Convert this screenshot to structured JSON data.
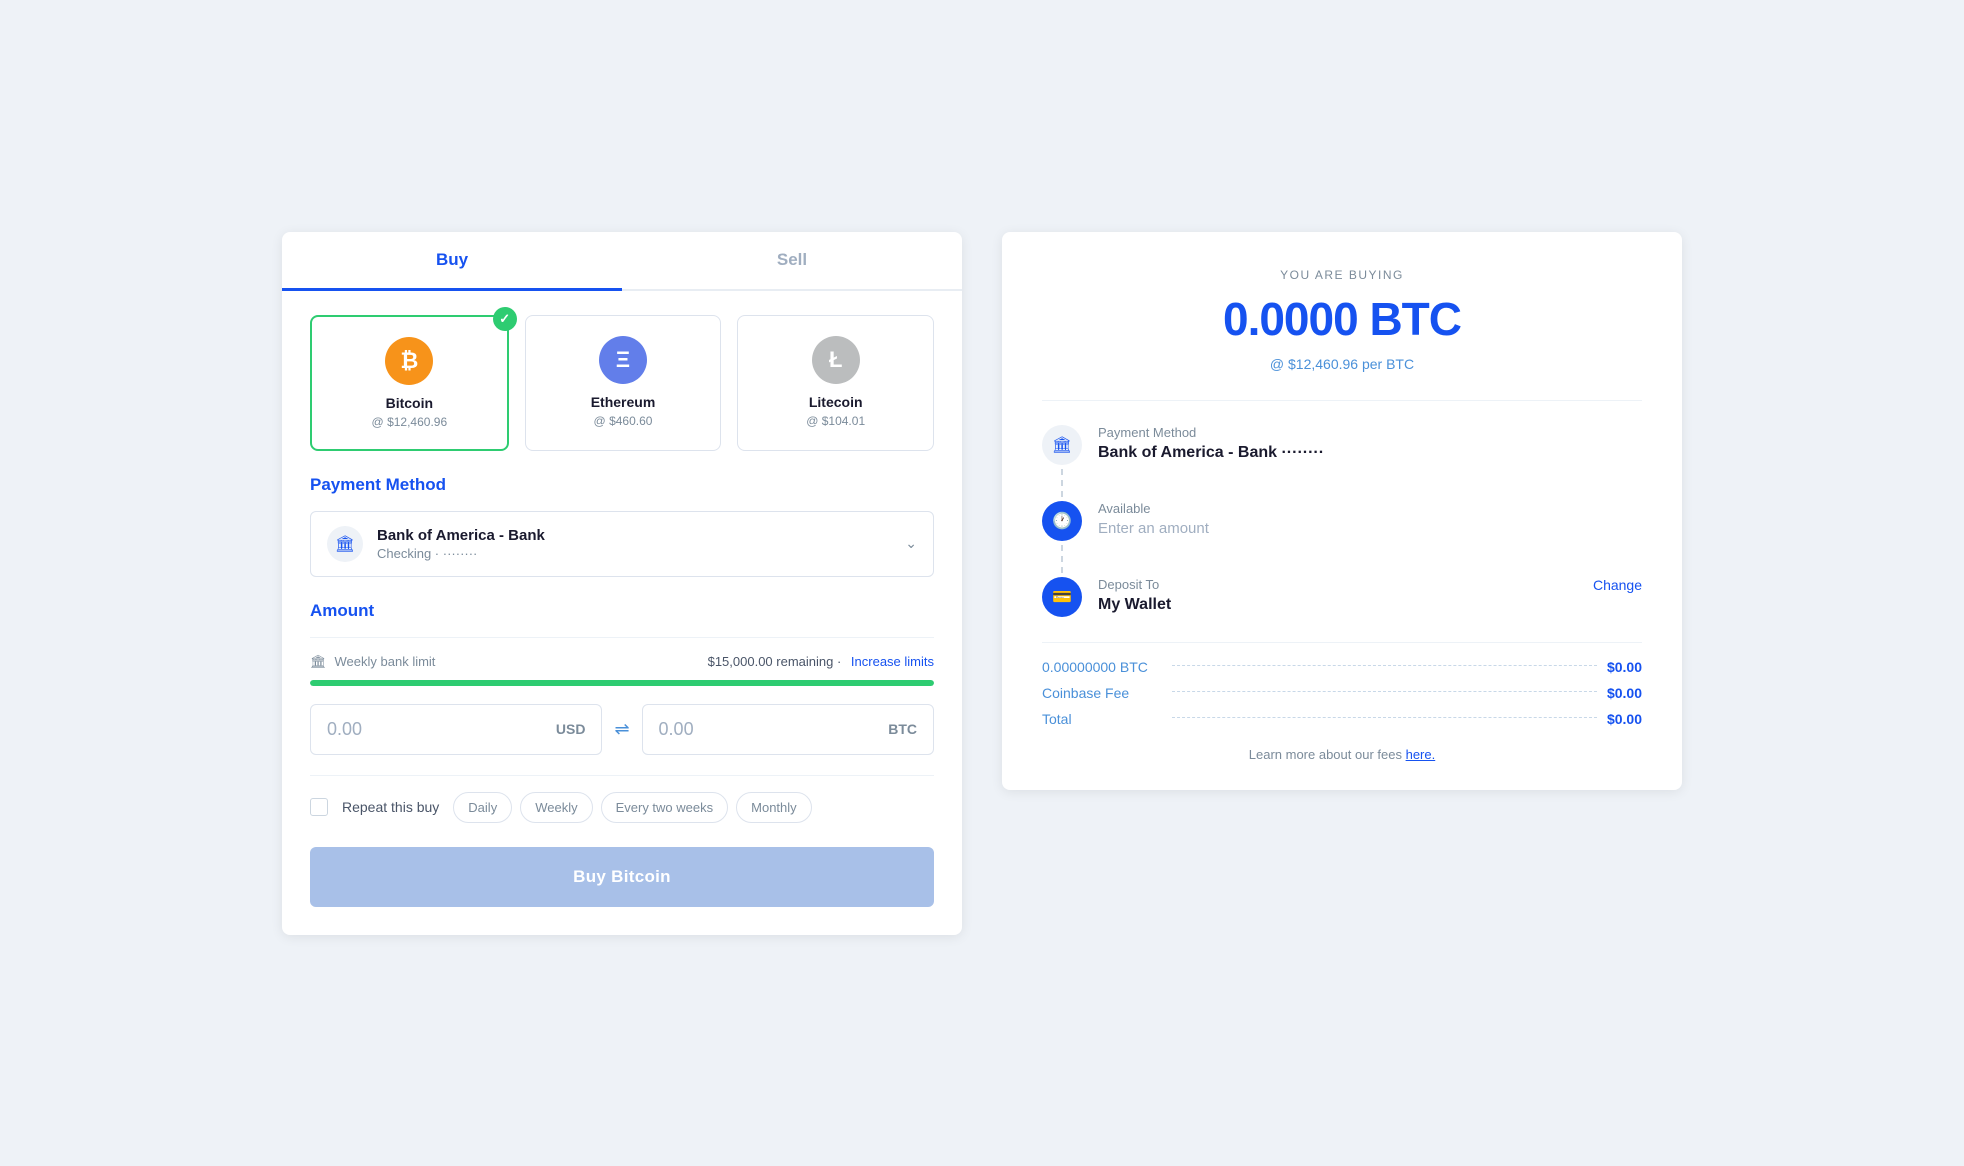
{
  "tabs": {
    "buy": "Buy",
    "sell": "Sell"
  },
  "cryptos": [
    {
      "id": "btc",
      "name": "Bitcoin",
      "price": "@ $12,460.96",
      "symbol": "₿",
      "selected": true
    },
    {
      "id": "eth",
      "name": "Ethereum",
      "price": "@ $460.60",
      "symbol": "Ξ",
      "selected": false
    },
    {
      "id": "ltc",
      "name": "Litecoin",
      "price": "@ $104.01",
      "symbol": "Ł",
      "selected": false
    }
  ],
  "payment": {
    "section_label": "Payment Method",
    "bank_name": "Bank of America - Bank",
    "bank_sub": "Checking · ········"
  },
  "amount": {
    "section_label": "Amount",
    "limit_icon": "🏦",
    "limit_label": "Weekly bank limit",
    "limit_remaining": "$15,000.00 remaining",
    "limit_link": "Increase limits",
    "usd_value": "0.00",
    "usd_label": "USD",
    "btc_value": "0.00",
    "btc_label": "BTC"
  },
  "repeat": {
    "label": "Repeat this buy",
    "options": [
      "Daily",
      "Weekly",
      "Every two weeks",
      "Monthly"
    ]
  },
  "buy_button": "Buy Bitcoin",
  "right_panel": {
    "you_are_buying": "YOU ARE BUYING",
    "btc_amount": "0.0000 BTC",
    "btc_rate": "@ $12,460.96 per BTC",
    "payment_label": "Payment Method",
    "payment_value": "Bank of America - Bank ········",
    "available_label": "Available",
    "available_placeholder": "Enter an amount",
    "deposit_label": "Deposit To",
    "deposit_value": "My Wallet",
    "change_link": "Change",
    "fees": [
      {
        "label": "0.00000000 BTC",
        "value": "$0.00"
      },
      {
        "label": "Coinbase Fee",
        "value": "$0.00"
      },
      {
        "label": "Total",
        "value": "$0.00"
      }
    ],
    "learn_more_text": "Learn more about our fees",
    "learn_more_link": "here."
  }
}
